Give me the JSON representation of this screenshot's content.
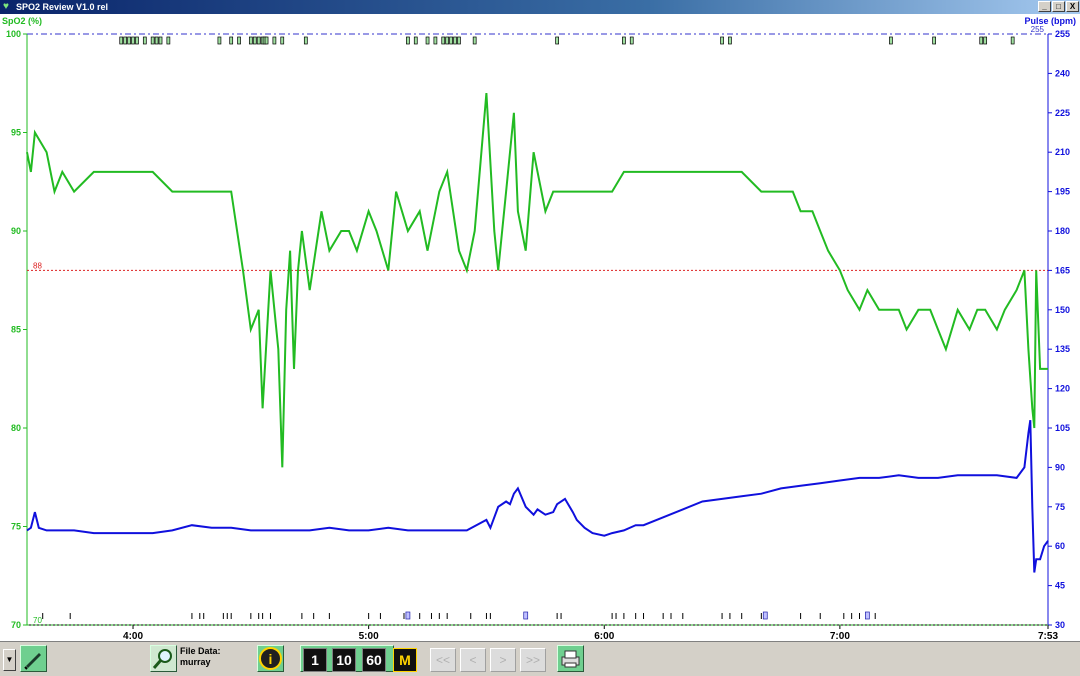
{
  "window": {
    "title": "SPO2 Review V1.0 rel",
    "buttons": [
      "_",
      "□",
      "X"
    ]
  },
  "chart_data": {
    "type": "line",
    "left_axis": {
      "label": "SpO2 (%)",
      "ticks": [
        100,
        95,
        90,
        85,
        80,
        75,
        70
      ],
      "range": [
        70,
        100
      ],
      "color": "#22bb22"
    },
    "right_axis": {
      "label": "Pulse (bpm)",
      "ticks": [
        255,
        240,
        225,
        210,
        195,
        180,
        165,
        150,
        135,
        120,
        105,
        90,
        75,
        60,
        45,
        30
      ],
      "range": [
        30,
        255
      ],
      "color": "#1010dd"
    },
    "x_axis": {
      "ticks": [
        "4:00",
        "5:00",
        "6:00",
        "7:00",
        "7:53"
      ],
      "tick_minutes": [
        240,
        300,
        360,
        420,
        473
      ],
      "range_minutes": [
        213,
        473
      ]
    },
    "threshold_lines": [
      {
        "axis": "left",
        "value": 88,
        "label": "88",
        "color": "#dd2222"
      },
      {
        "axis": "right",
        "value": 255,
        "label": "255",
        "color": "#3333cc"
      },
      {
        "axis": "left",
        "value": 70,
        "label": "70",
        "color": "#22bb22"
      }
    ],
    "series": [
      {
        "name": "SpO2 (%)",
        "axis": "left",
        "color": "#22bb22",
        "x": [
          213,
          214,
          215,
          218,
          220,
          222,
          225,
          230,
          235,
          240,
          245,
          250,
          255,
          260,
          265,
          268,
          270,
          272,
          273,
          275,
          277,
          278,
          279,
          280,
          281,
          282,
          283,
          285,
          288,
          290,
          293,
          295,
          297,
          300,
          302,
          305,
          307,
          310,
          313,
          315,
          318,
          320,
          323,
          325,
          327,
          330,
          332,
          333,
          335,
          337,
          338,
          340,
          342,
          345,
          347,
          350,
          353,
          355,
          357,
          360,
          362,
          365,
          368,
          370,
          375,
          380,
          385,
          390,
          395,
          400,
          402,
          405,
          408,
          410,
          413,
          415,
          417,
          420,
          422,
          425,
          427,
          430,
          433,
          435,
          437,
          440,
          443,
          445,
          447,
          450,
          453,
          455,
          457,
          460,
          462,
          465,
          467,
          468,
          469,
          469.5,
          470,
          471,
          473
        ],
        "y": [
          94,
          93,
          95,
          94,
          92,
          93,
          92,
          93,
          93,
          93,
          93,
          92,
          92,
          92,
          92,
          88,
          85,
          86,
          81,
          88,
          84,
          78,
          86,
          89,
          83,
          88,
          90,
          87,
          91,
          89,
          90,
          90,
          89,
          91,
          90,
          88,
          92,
          90,
          91,
          89,
          92,
          93,
          89,
          88,
          90,
          97,
          90,
          88,
          92,
          96,
          91,
          89,
          94,
          91,
          92,
          92,
          92,
          92,
          92,
          92,
          92,
          93,
          93,
          93,
          93,
          93,
          93,
          93,
          93,
          92,
          92,
          92,
          92,
          91,
          91,
          90,
          89,
          88,
          87,
          86,
          87,
          86,
          86,
          86,
          85,
          86,
          86,
          85,
          84,
          86,
          85,
          86,
          86,
          85,
          86,
          87,
          88,
          84,
          81,
          80,
          88,
          83,
          83
        ]
      },
      {
        "name": "Pulse (bpm)",
        "axis": "right",
        "color": "#1010dd",
        "x": [
          213,
          214,
          215,
          216,
          218,
          220,
          225,
          230,
          235,
          240,
          245,
          250,
          255,
          260,
          265,
          270,
          275,
          280,
          285,
          290,
          295,
          300,
          305,
          310,
          315,
          320,
          325,
          330,
          331,
          333,
          335,
          336,
          337,
          338,
          340,
          342,
          343,
          345,
          347,
          348,
          350,
          352,
          353,
          355,
          357,
          360,
          362,
          365,
          368,
          370,
          375,
          380,
          385,
          390,
          395,
          400,
          405,
          410,
          415,
          420,
          425,
          430,
          435,
          440,
          445,
          450,
          455,
          460,
          465,
          467,
          468,
          468.5,
          469,
          469.5,
          470,
          471,
          472,
          473
        ],
        "y": [
          66,
          67,
          73,
          67,
          66,
          66,
          66,
          65,
          65,
          65,
          65,
          66,
          68,
          67,
          67,
          66,
          66,
          66,
          66,
          67,
          66,
          66,
          67,
          66,
          66,
          66,
          66,
          70,
          67,
          75,
          77,
          76,
          80,
          82,
          75,
          72,
          74,
          72,
          73,
          76,
          78,
          73,
          70,
          67,
          65,
          64,
          65,
          66,
          68,
          68,
          71,
          74,
          77,
          78,
          79,
          80,
          82,
          83,
          84,
          85,
          86,
          86,
          87,
          86,
          86,
          87,
          87,
          87,
          86,
          90,
          103,
          108,
          75,
          50,
          55,
          55,
          60,
          62
        ]
      }
    ],
    "event_markers": {
      "top_minutes": [
        237,
        238,
        239,
        240,
        241,
        243,
        245,
        246,
        247,
        249,
        262,
        265,
        267,
        270,
        271,
        272,
        273,
        273.5,
        274,
        276,
        278,
        284,
        310,
        312,
        315,
        317,
        319,
        320,
        321,
        322,
        323,
        327,
        348,
        365,
        367,
        390,
        392,
        433,
        444,
        456,
        457,
        464
      ],
      "bottom_minutes": [
        217,
        224,
        255,
        257,
        258,
        263,
        264,
        265,
        270,
        272,
        273,
        275,
        283,
        286,
        290,
        300,
        303,
        309,
        313,
        316,
        318,
        320,
        326,
        330,
        331,
        348,
        349,
        362,
        363,
        365,
        368,
        370,
        375,
        377,
        380,
        390,
        392,
        395,
        400,
        410,
        415,
        421,
        423,
        425,
        429
      ],
      "box_minutes": [
        310,
        340,
        401,
        427
      ]
    }
  },
  "toolbar": {
    "file_data_label": "File Data:",
    "file_data_value": "murray",
    "scale_buttons": [
      "1",
      "10",
      "60",
      "M"
    ],
    "info_label": "i",
    "nav_buttons": [
      "<<",
      "<",
      ">",
      ">>"
    ]
  }
}
